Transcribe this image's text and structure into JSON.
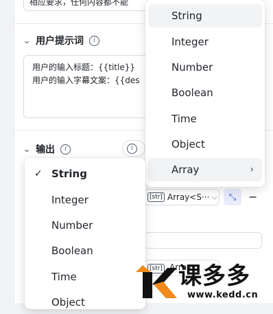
{
  "system_prompt": {
    "value_preview": "相应要求，任何内容都不能"
  },
  "user_prompt_section": {
    "title": "用户提示词",
    "lines": [
      "用户的输入标题：{{title}}",
      "用户的输入字幕文案：{{des"
    ]
  },
  "output_section": {
    "title": "输出",
    "row1": {
      "type_tag": "[str]",
      "type_value": "Array<S···"
    },
    "row2": {
      "type_tag": "[str]",
      "type_value": "Array"
    }
  },
  "type_dropdown_top": {
    "items": [
      "String",
      "Integer",
      "Number",
      "Boolean",
      "Time",
      "Object",
      "Array"
    ],
    "hovered": "String",
    "highlighted": "Array"
  },
  "type_dropdown_left": {
    "items": [
      "String",
      "Integer",
      "Number",
      "Boolean",
      "Time",
      "Object"
    ],
    "selected": "String"
  },
  "watermark": {
    "title": "课多多",
    "url": "www.kedd.cn"
  },
  "colors": {
    "accent": "#3250d8",
    "logo_orange": "#f08a1c"
  }
}
